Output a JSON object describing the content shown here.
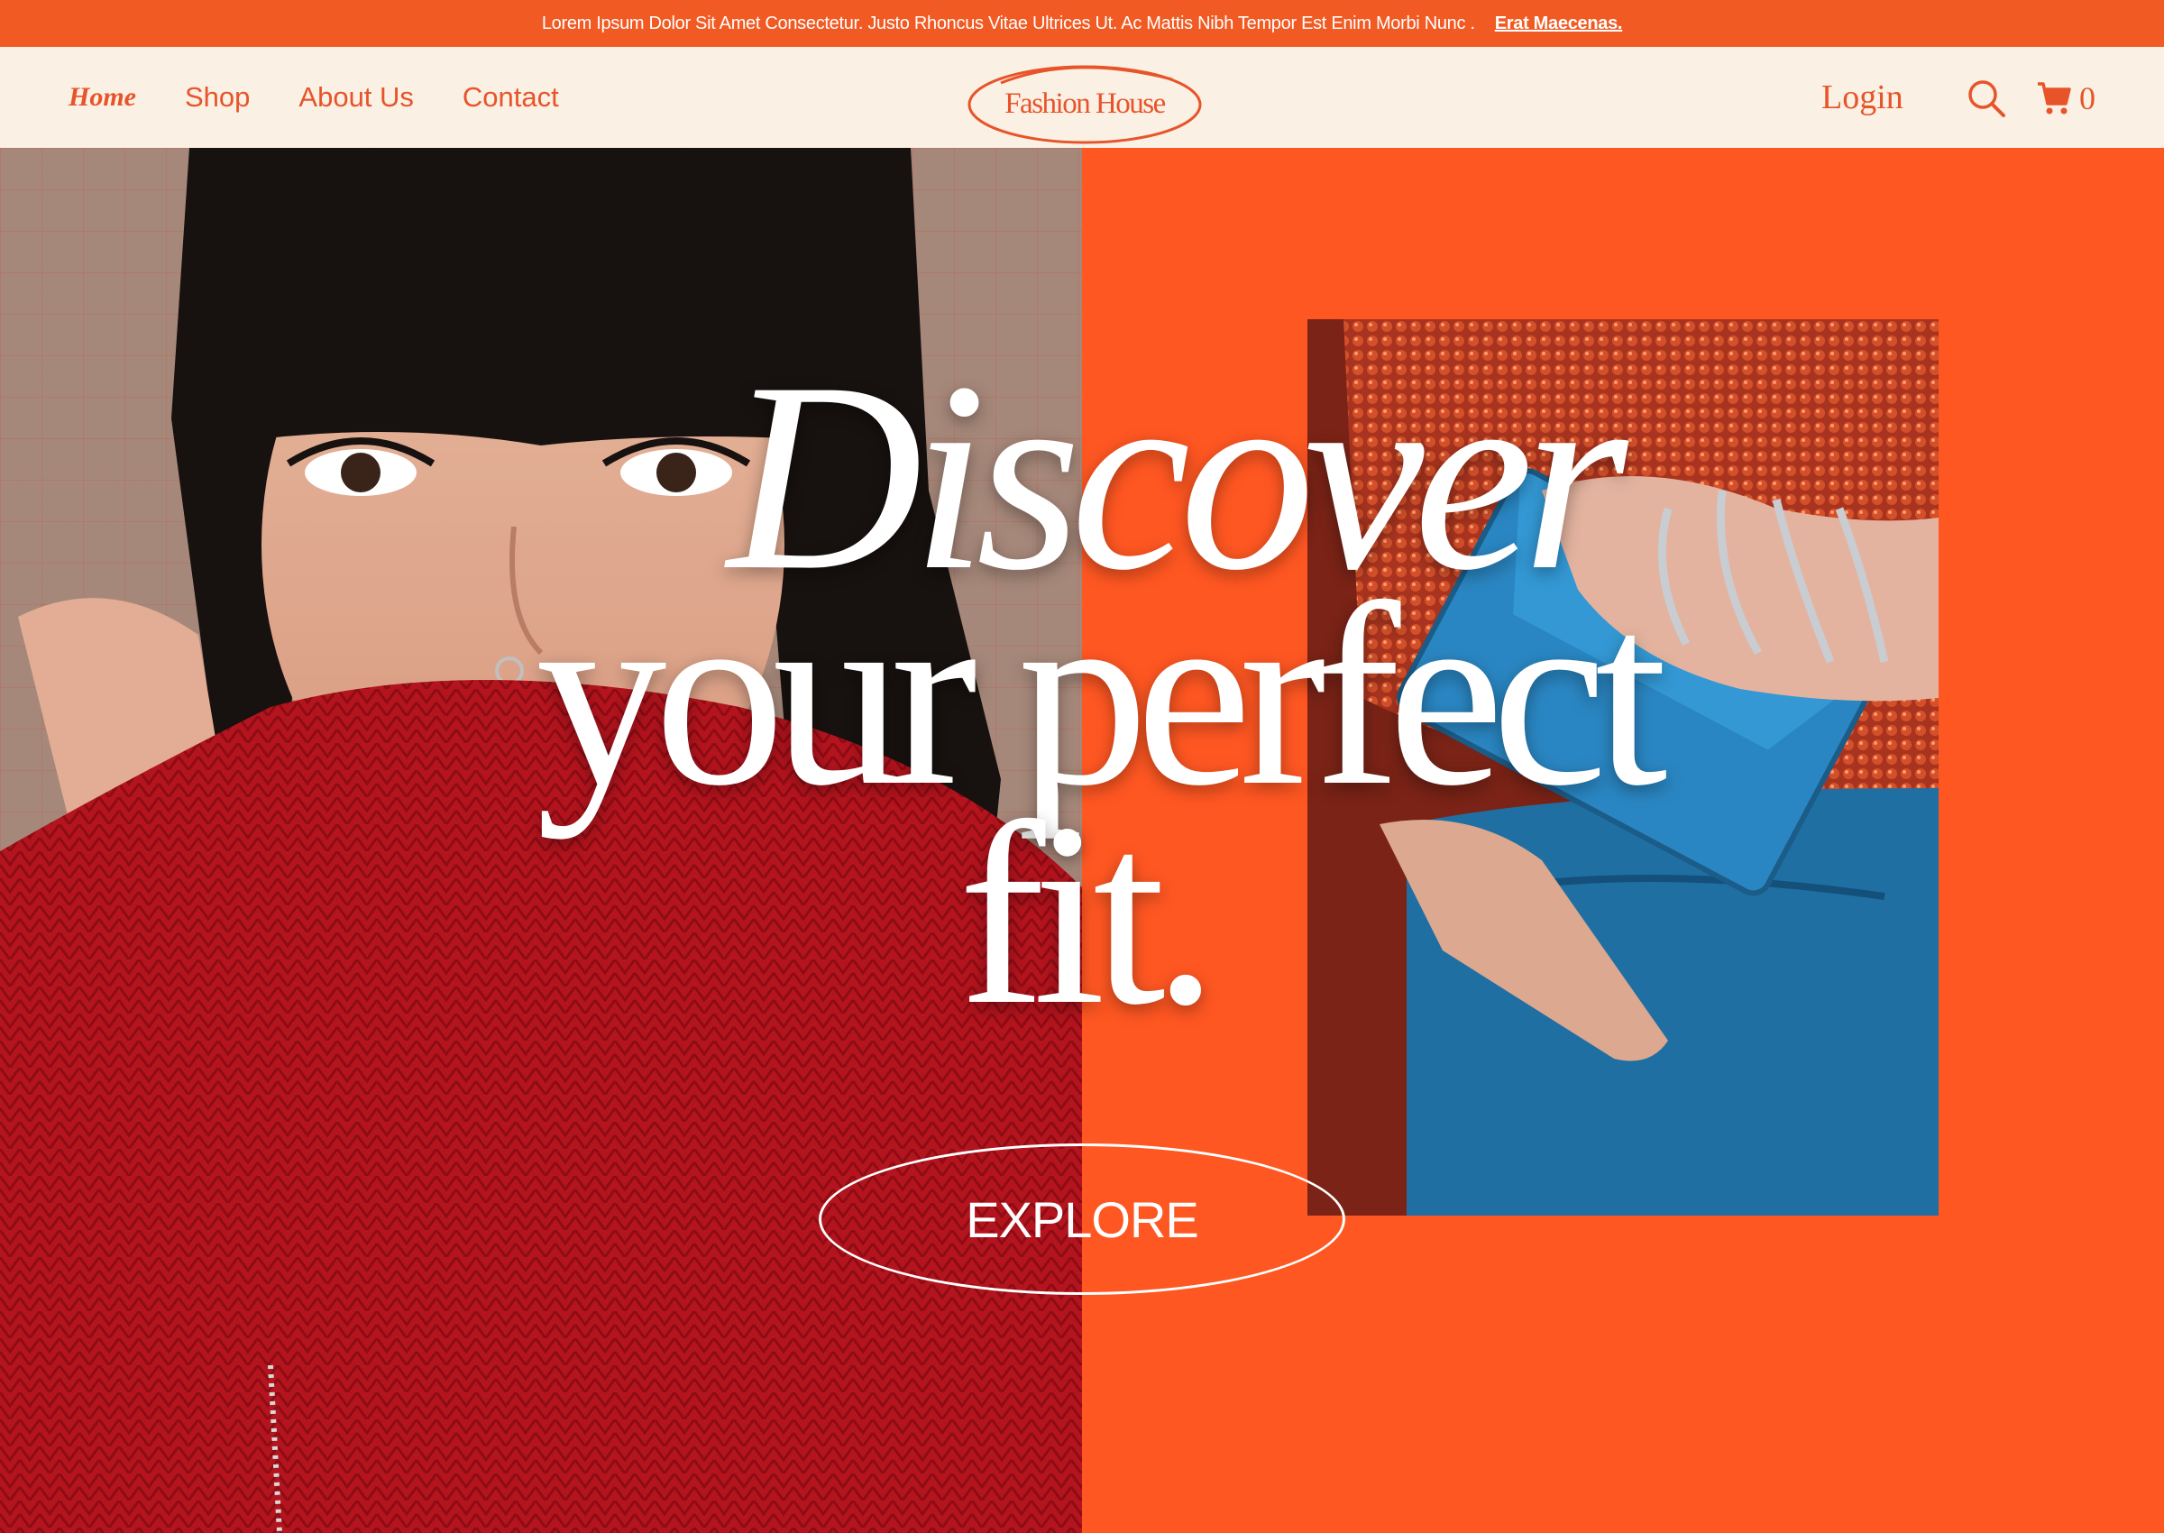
{
  "announcement": {
    "text": "Lorem Ipsum Dolor Sit Amet Consectetur. Justo Rhoncus Vitae Ultrices Ut. Ac Mattis Nibh Tempor Est Enim Morbi Nunc .",
    "link": "Erat Maecenas."
  },
  "nav": {
    "items": [
      {
        "label": "Home"
      },
      {
        "label": "Shop"
      },
      {
        "label": "About Us"
      },
      {
        "label": "Contact"
      }
    ],
    "logo": "Fashion House",
    "login": "Login",
    "cart_count": "0"
  },
  "hero": {
    "line1": "Discover",
    "line2": "your perfect",
    "line3": "fit.",
    "cta": "EXPLORE"
  },
  "colors": {
    "brand": "#e8542a",
    "announce_bg": "#f15a22",
    "nav_bg": "#faf0e3",
    "hero_orange": "#ff5722"
  },
  "icons": [
    "search-icon",
    "cart-icon"
  ]
}
